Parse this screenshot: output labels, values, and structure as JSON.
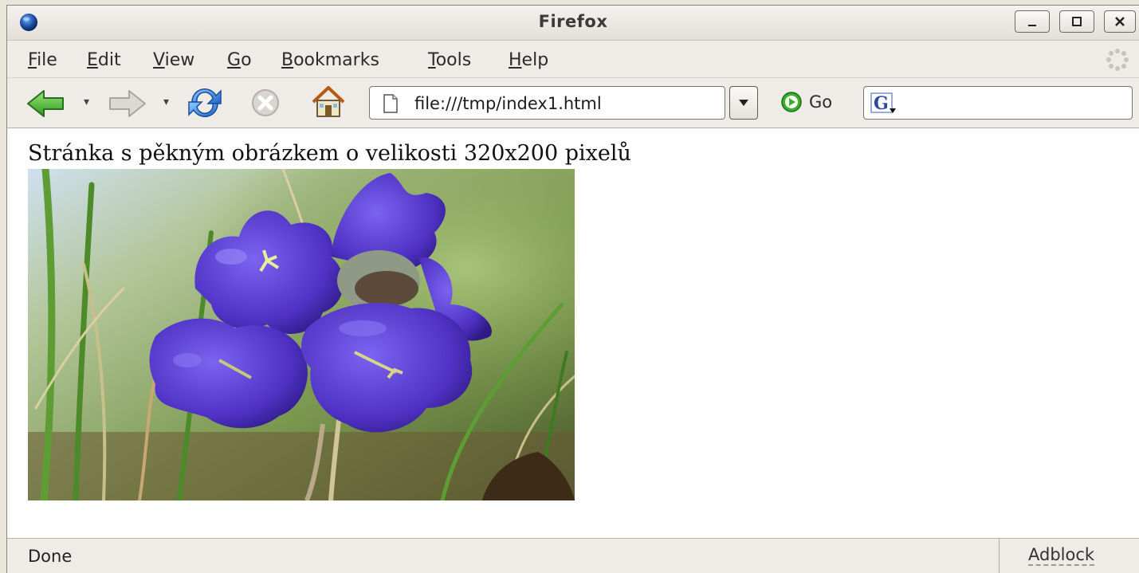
{
  "window": {
    "title": "Firefox"
  },
  "menu": [
    {
      "label": "File",
      "accel": "F",
      "rest": "ile"
    },
    {
      "label": "Edit",
      "accel": "E",
      "rest": "dit"
    },
    {
      "label": "View",
      "accel": "V",
      "rest": "iew"
    },
    {
      "label": "Go",
      "accel": "G",
      "rest": "o"
    },
    {
      "label": "Bookmarks",
      "accel": "B",
      "rest": "ookmarks"
    },
    {
      "label": "Tools",
      "accel": "T",
      "rest": "ools"
    },
    {
      "label": "Help",
      "accel": "H",
      "rest": "elp"
    }
  ],
  "toolbar": {
    "url": "file:///tmp/index1.html",
    "go_label": "Go",
    "search_engine_icon": "google-g-icon"
  },
  "content": {
    "text": "Stránka s pěkným obrázkem o velikosti 320x200 pixelů",
    "image_subject": "photo-purple-bellflowers"
  },
  "status": {
    "text": "Done",
    "extension": "Adblock"
  },
  "colors": {
    "link_green": "#3fa63a",
    "flower_purple": "#5b3fd0"
  }
}
